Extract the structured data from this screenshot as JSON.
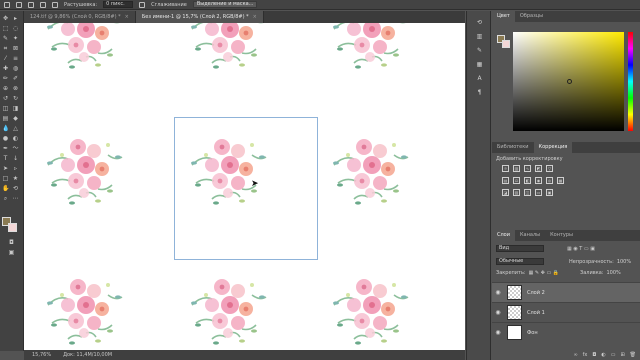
{
  "options_bar": {
    "feather_label": "Растушевка:",
    "feather_value": "0 пикс.",
    "antialias_label": "Сглаживание",
    "select_mask_button": "Выделение и маска..."
  },
  "tabs": [
    {
      "label": "124.tif @ 9,86% (Слой 0, RGB/8#) *",
      "close": "×"
    },
    {
      "label": "Без имени-1 @ 15,7% (Слой 2, RGB/8#) *",
      "close": "×"
    }
  ],
  "toolbar": {
    "tools": [
      "move-tool",
      "marquee-tool",
      "lasso-tool",
      "quick-select-tool",
      "crop-tool",
      "frame-tool",
      "eyedropper-tool",
      "healing-tool",
      "brush-tool",
      "clone-tool",
      "history-brush-tool",
      "eraser-tool",
      "gradient-tool",
      "blur-tool",
      "dodge-tool",
      "pen-tool",
      "type-tool",
      "path-select-tool",
      "shape-tool",
      "hand-tool",
      "zoom-tool",
      "more-tools"
    ],
    "foreground_color": "#8a7a52",
    "background_color": "#f2d6d6"
  },
  "status": {
    "zoom": "15,76%",
    "doc": "Док: 11,4M/10,00M"
  },
  "color_panel": {
    "tabs": [
      "Цвет",
      "Образцы"
    ],
    "foreground": "#8a7a52",
    "background": "#f2d6d6"
  },
  "adjust_panel": {
    "tabs": [
      "Библиотеки",
      "Коррекция"
    ],
    "title": "Добавить корректировку"
  },
  "layers_panel": {
    "tabs": [
      "Слои",
      "Каналы",
      "Контуры"
    ],
    "kind_filter": "Вид",
    "blend_mode": "Обычные",
    "opacity_label": "Непрозрачность:",
    "opacity_value": "100%",
    "lock_label": "Закрепить:",
    "fill_label": "Заливка:",
    "fill_value": "100%",
    "layers": [
      {
        "name": "Слой 2",
        "selected": true,
        "thumb": "transparent"
      },
      {
        "name": "Слой 1",
        "selected": false,
        "thumb": "transparent"
      },
      {
        "name": "Фон",
        "selected": false,
        "thumb": "white"
      }
    ]
  }
}
